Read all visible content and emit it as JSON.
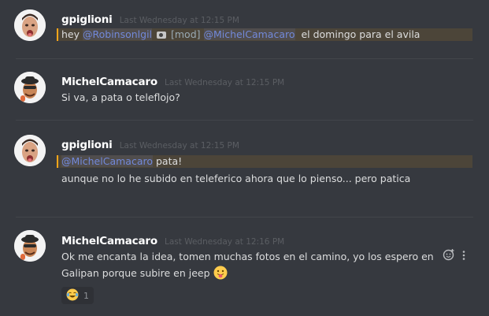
{
  "messages": [
    {
      "username": "gpiglioni",
      "timestamp": "Last Wednesday at 12:15 PM",
      "line1": {
        "pre": "hey ",
        "mention1": "@Robinsonlgil",
        "mod": "[mod]",
        "mention2": "@MichelCamacaro",
        "post": "  el domingo para el avila"
      }
    },
    {
      "username": "MichelCamacaro",
      "timestamp": "Last Wednesday at 12:15 PM",
      "line1": "Si va, a pata o teleflojo?"
    },
    {
      "username": "gpiglioni",
      "timestamp": "Last Wednesday at 12:15 PM",
      "line1": {
        "mention": "@MichelCamacaro",
        "post": " pata!"
      },
      "line2": "aunque no lo he subido en teleferico ahora que lo pienso... pero patica"
    },
    {
      "username": "MichelCamacaro",
      "timestamp": "Last Wednesday at 12:16 PM",
      "line1": "Ok me encanta la idea, tomen muchas fotos en el camino, yo los espero en",
      "line2": "Galipan porque subire en jeep",
      "reaction": {
        "emoji": "joy-emoji",
        "count": "1"
      }
    }
  ],
  "icons": {
    "add_reaction": "add-reaction-icon",
    "more": "more-options-icon",
    "camera": "camera-emoji",
    "tongue": "tongue-emoji"
  },
  "colors": {
    "background": "#36393f",
    "mention": "#7289da",
    "highlight": "#4c4539",
    "highlight_bar": "#faa61a"
  }
}
